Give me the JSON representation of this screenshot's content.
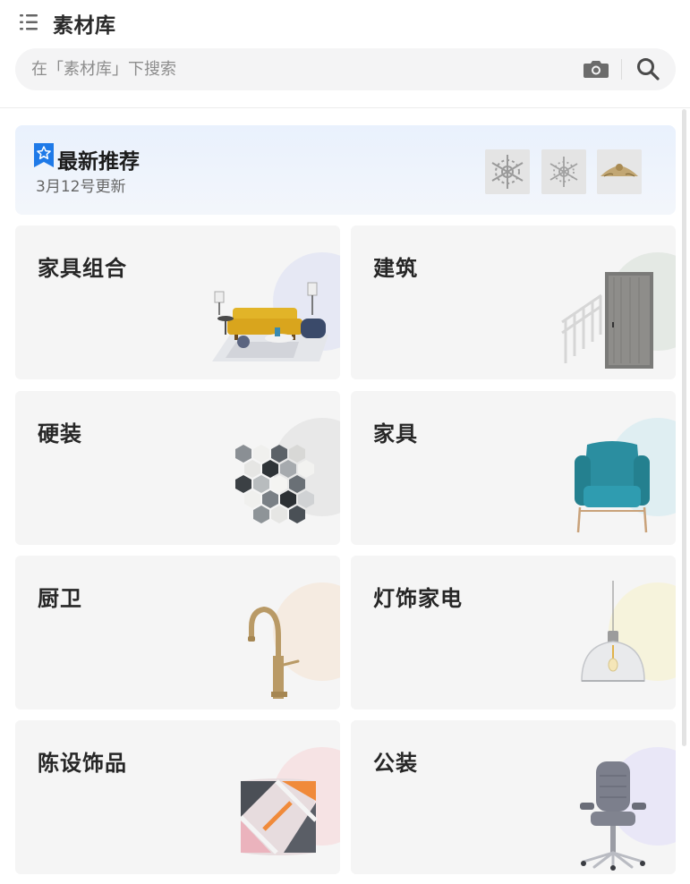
{
  "header": {
    "title": "素材库",
    "menu_icon": "list-menu-icon"
  },
  "search": {
    "placeholder": "在「素材库」下搜索",
    "value": "",
    "camera_icon": "camera-icon",
    "search_icon": "search-icon"
  },
  "banner": {
    "title": "最新推荐",
    "subtitle": "3月12号更新",
    "badge_icon": "star-bookmark-icon",
    "thumbnails": [
      "snowflake-ornament",
      "snowflake-ornament",
      "gold-relief-ornament"
    ]
  },
  "categories": [
    {
      "label": "家具组合",
      "image": "living-room-set",
      "accent": "#e6e8f4"
    },
    {
      "label": "建筑",
      "image": "door-and-railing",
      "accent": "#e4e9e4"
    },
    {
      "label": "硬装",
      "image": "hexagon-tiles",
      "accent": "#e8e8e8"
    },
    {
      "label": "家具",
      "image": "teal-armchair",
      "accent": "#dfeef2"
    },
    {
      "label": "厨卫",
      "image": "gold-faucet",
      "accent": "#f5ebe1"
    },
    {
      "label": "灯饰家电",
      "image": "glass-pendant-lamp",
      "accent": "#f6f3dc"
    },
    {
      "label": "陈设饰品",
      "image": "decorative-pillow",
      "accent": "#f6e3e4"
    },
    {
      "label": "公装",
      "image": "office-chair",
      "accent": "#e9e7f7"
    }
  ]
}
